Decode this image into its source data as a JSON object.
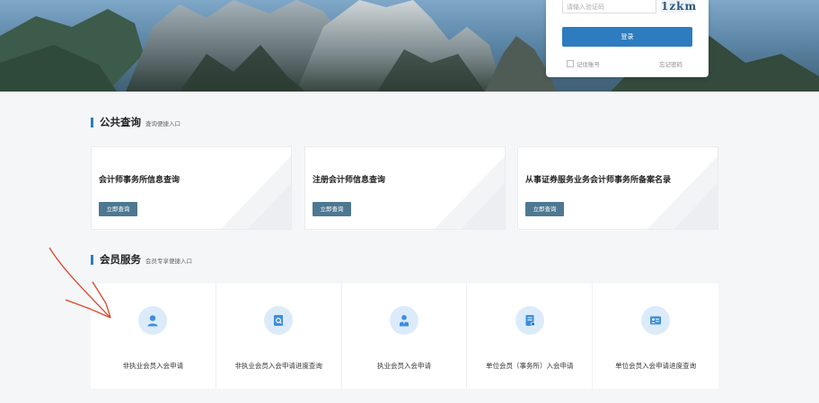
{
  "login": {
    "captcha_placeholder": "请输入验证码",
    "captcha_text": "1zkm",
    "login_button": "登录",
    "remember_label": "记住账号",
    "forgot_label": "忘记密码"
  },
  "public_query": {
    "title": "公共查询",
    "subtitle": "查询便捷入口",
    "cards": [
      {
        "title": "会计师事务所信息查询",
        "button": "立即查询"
      },
      {
        "title": "注册会计师信息查询",
        "button": "立即查询"
      },
      {
        "title": "从事证券服务业务会计师事务所备案名录",
        "button": "立即查询"
      }
    ]
  },
  "member_service": {
    "title": "会员服务",
    "subtitle": "会员专享便捷入口",
    "items": [
      {
        "label": "非执业会员入会申请",
        "icon": "person-icon"
      },
      {
        "label": "非执业会员入会申请进度查询",
        "icon": "document-search-icon"
      },
      {
        "label": "执业会员入会申请",
        "icon": "professional-person-icon"
      },
      {
        "label": "单位会员（事务所）入会申请",
        "icon": "file-form-icon"
      },
      {
        "label": "单位会员入会申请进度查询",
        "icon": "id-card-icon"
      }
    ]
  },
  "colors": {
    "accent": "#2d7cc0",
    "query_button": "#4e7891",
    "icon_bg": "#dcebfa",
    "icon_fg": "#3d8ee0",
    "annotation_arrow": "#d9472b"
  }
}
